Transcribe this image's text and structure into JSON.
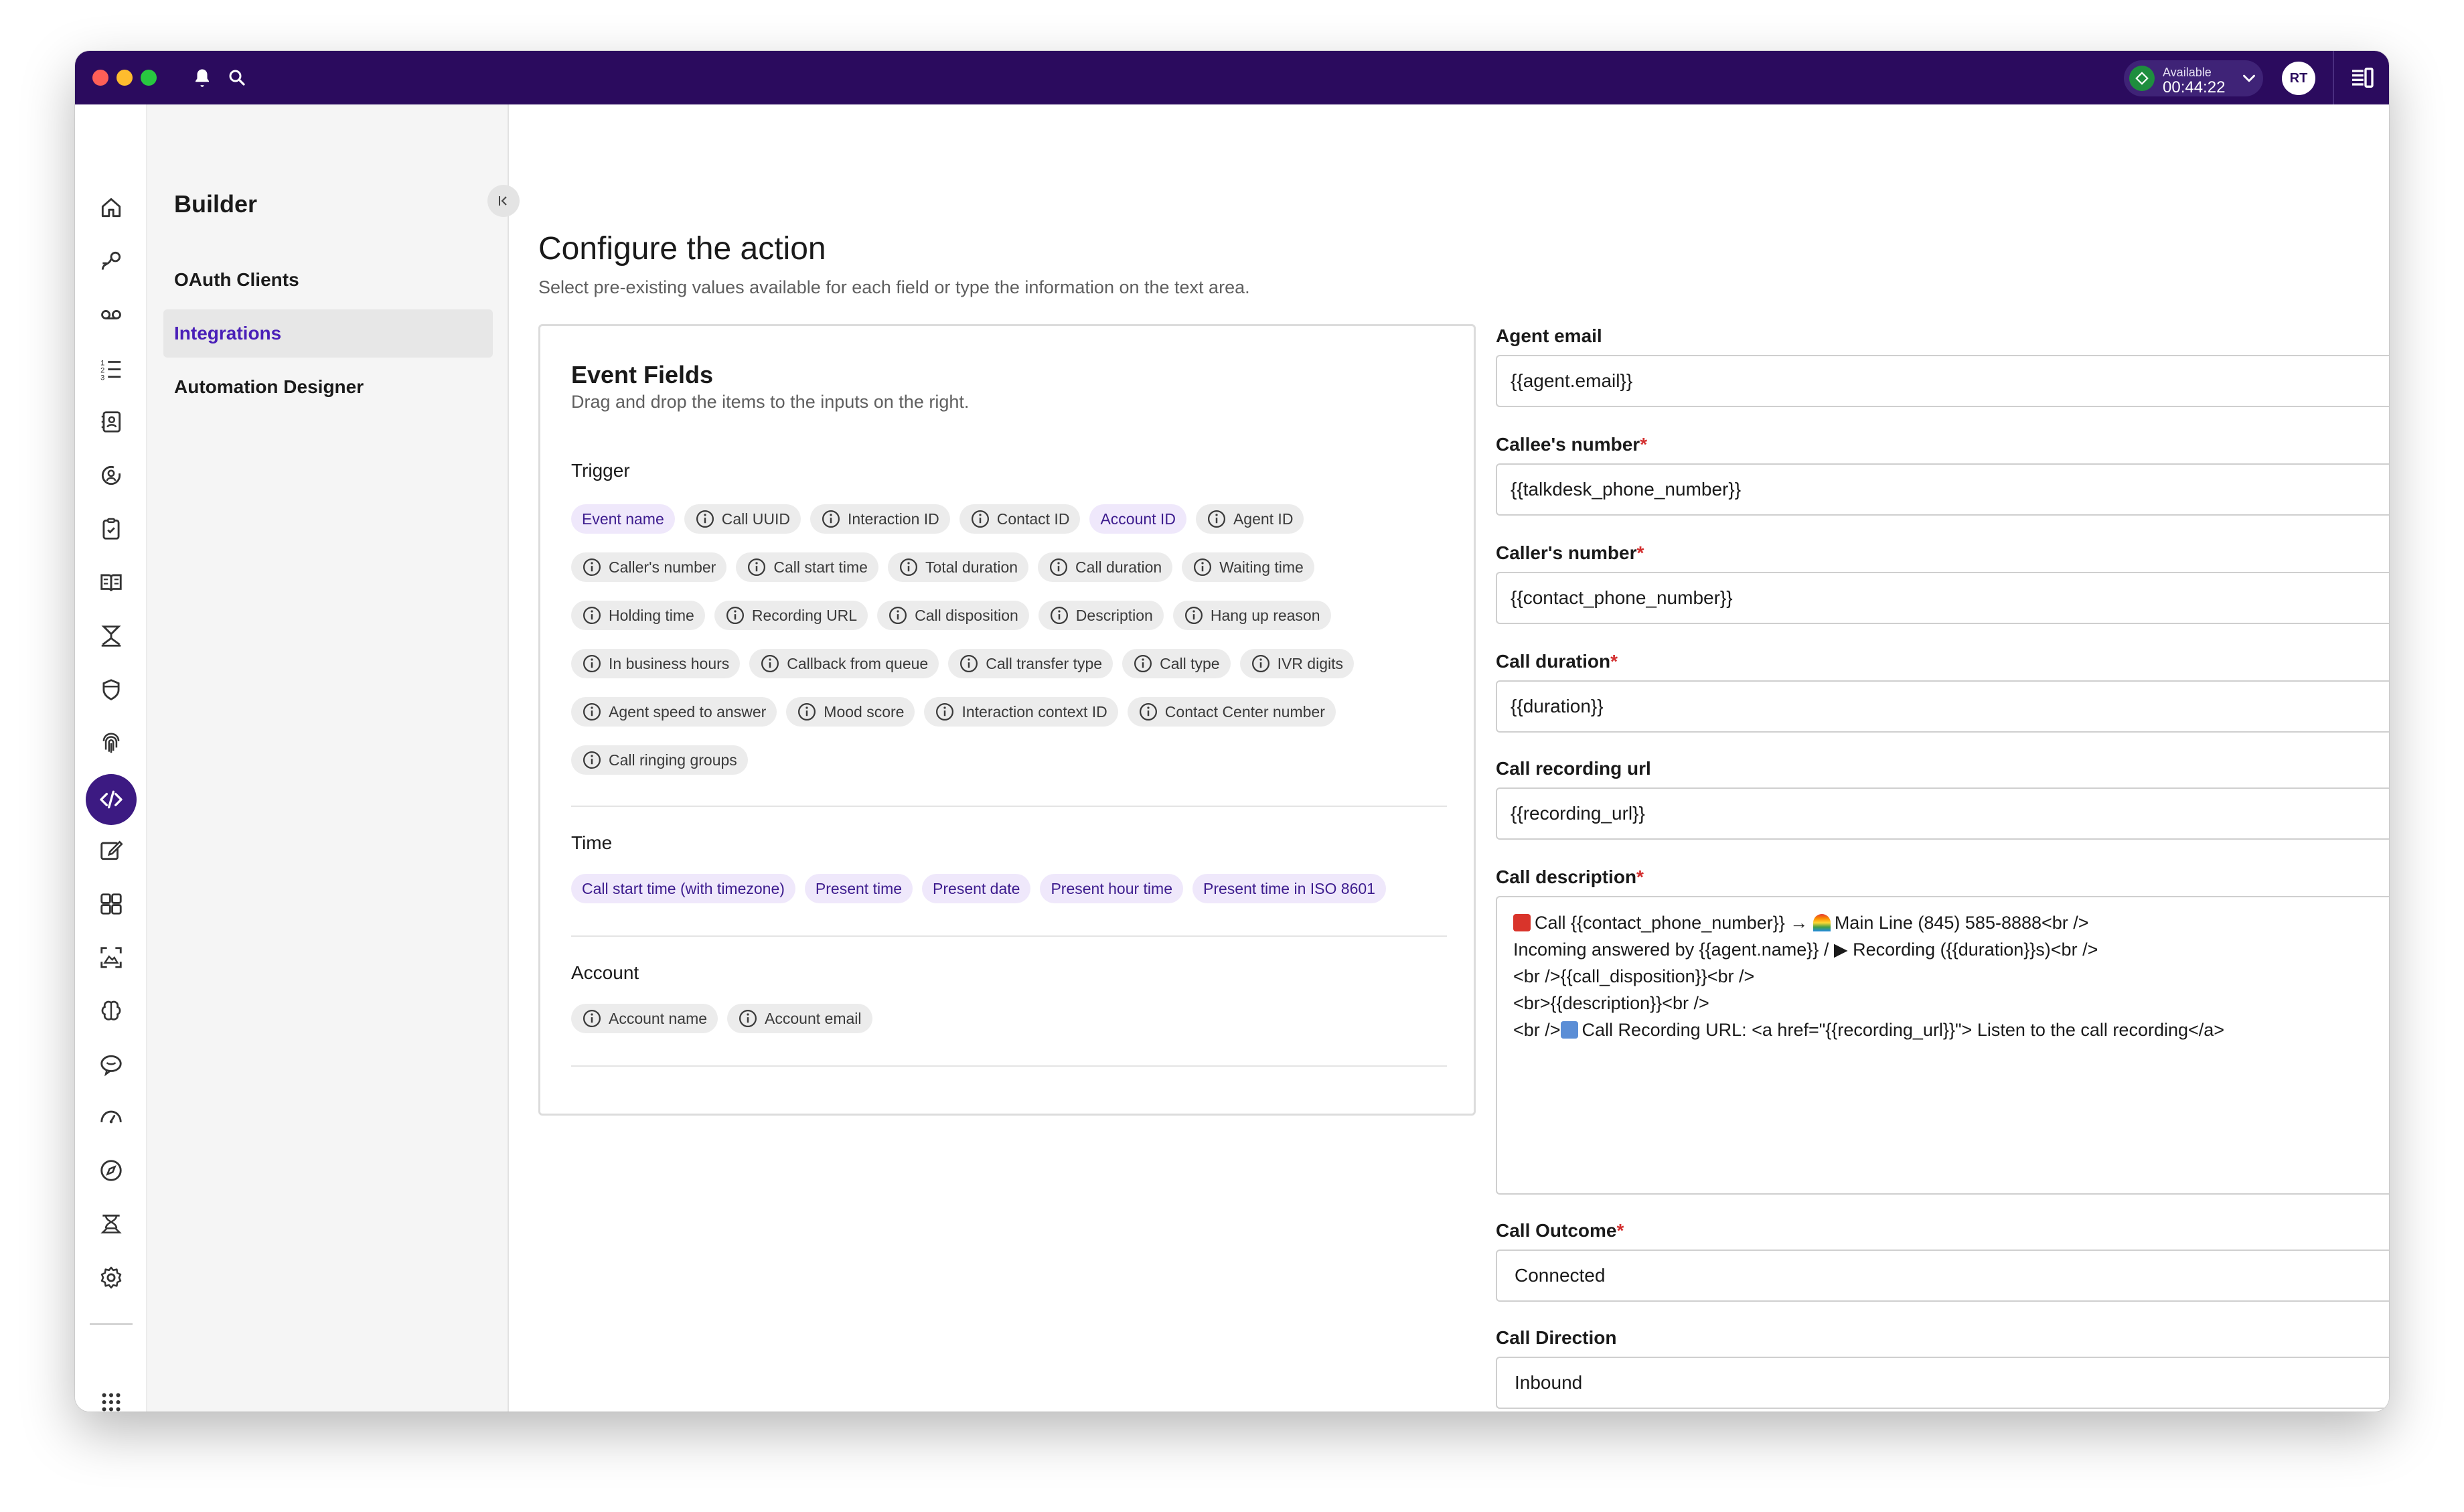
{
  "statusbar": {
    "status_label": "Available",
    "status_time": "00:44:22",
    "avatar_initials": "RT"
  },
  "sidebar": {
    "title": "Builder",
    "items": [
      {
        "label": "OAuth Clients"
      },
      {
        "label": "Integrations"
      },
      {
        "label": "Automation Designer"
      }
    ]
  },
  "main": {
    "title": "Configure the action",
    "subtitle": "Select pre-existing values available for each field or type the information on the text area."
  },
  "event_fields": {
    "title": "Event Fields",
    "subtitle": "Drag and drop the items to the inputs on the right.",
    "sections": [
      {
        "label": "Trigger",
        "rows": [
          [
            {
              "label": "Event name",
              "kind": "var"
            },
            {
              "label": "Call UUID",
              "kind": "info"
            },
            {
              "label": "Interaction ID",
              "kind": "info"
            },
            {
              "label": "Contact ID",
              "kind": "info"
            },
            {
              "label": "Account ID",
              "kind": "var"
            },
            {
              "label": "Agent ID",
              "kind": "info"
            }
          ],
          [
            {
              "label": "Caller's number",
              "kind": "info"
            },
            {
              "label": "Call start time",
              "kind": "info"
            },
            {
              "label": "Total duration",
              "kind": "info"
            },
            {
              "label": "Call duration",
              "kind": "info"
            },
            {
              "label": "Waiting time",
              "kind": "info"
            }
          ],
          [
            {
              "label": "Holding time",
              "kind": "info"
            },
            {
              "label": "Recording URL",
              "kind": "info"
            },
            {
              "label": "Call disposition",
              "kind": "info"
            },
            {
              "label": "Description",
              "kind": "info"
            },
            {
              "label": "Hang up reason",
              "kind": "info"
            }
          ],
          [
            {
              "label": "In business hours",
              "kind": "info"
            },
            {
              "label": "Callback from queue",
              "kind": "info"
            },
            {
              "label": "Call transfer type",
              "kind": "info"
            },
            {
              "label": "Call type",
              "kind": "info"
            },
            {
              "label": "IVR digits",
              "kind": "info"
            }
          ],
          [
            {
              "label": "Agent speed to answer",
              "kind": "info"
            },
            {
              "label": "Mood score",
              "kind": "info"
            },
            {
              "label": "Interaction context ID",
              "kind": "info"
            },
            {
              "label": "Contact Center number",
              "kind": "info"
            }
          ],
          [
            {
              "label": "Call ringing groups",
              "kind": "info"
            }
          ]
        ]
      },
      {
        "label": "Time",
        "rows": [
          [
            {
              "label": "Call start time (with timezone)",
              "kind": "var"
            },
            {
              "label": "Present time",
              "kind": "var"
            },
            {
              "label": "Present date",
              "kind": "var"
            },
            {
              "label": "Present hour time",
              "kind": "var"
            },
            {
              "label": "Present time in ISO 8601",
              "kind": "var"
            }
          ]
        ]
      },
      {
        "label": "Account",
        "rows": [
          [
            {
              "label": "Account name",
              "kind": "info"
            },
            {
              "label": "Account email",
              "kind": "info"
            }
          ]
        ]
      }
    ]
  },
  "form": {
    "agent_email": {
      "label": "Agent email",
      "required": "",
      "value": "{{agent.email}}"
    },
    "callee_number": {
      "label": "Callee's number",
      "required": "*",
      "value": "{{talkdesk_phone_number}}"
    },
    "caller_number": {
      "label": "Caller's number",
      "required": "*",
      "value": "{{contact_phone_number}}"
    },
    "call_duration": {
      "label": "Call duration",
      "required": "*",
      "value": "{{duration}}"
    },
    "call_recording_url": {
      "label": "Call recording url",
      "required": "",
      "value": "{{recording_url}}"
    },
    "call_description": {
      "label": "Call description",
      "required": "*",
      "lines": [
        "Call {{contact_phone_number}} → ",
        "Main Line (845) 585-8888<br />",
        "Incoming answered by {{agent.name}} / ▶ Recording ({{duration}}s)<br />",
        "<br />{{call_disposition}}<br />",
        "<br>{{description}}<br />",
        "<br />",
        "Call Recording URL: <a href=\"{{recording_url}}\"> Listen to the call recording</a>"
      ]
    },
    "call_outcome": {
      "label": "Call Outcome",
      "required": "*",
      "value": "Connected"
    },
    "call_direction": {
      "label": "Call Direction",
      "required": "",
      "value": "Inbound"
    }
  },
  "colors": {
    "topbar": "#2b0b5e",
    "accent": "#4a1fb8",
    "status_green": "#1e8e3e",
    "required": "#d32f2f"
  },
  "icons": {
    "rail": [
      "home-icon",
      "routing-icon",
      "voicemail-icon",
      "list-icon",
      "contacts-icon",
      "agent-icon",
      "clipboard-icon",
      "book-icon",
      "flow-icon",
      "shield-icon",
      "fingerprint-icon",
      "code-icon",
      "edit-icon",
      "apps-icon",
      "capture-icon",
      "brain-icon",
      "chat-icon",
      "gauge-icon",
      "compass-icon",
      "studio-icon",
      "settings-icon",
      "grid-icon"
    ]
  }
}
